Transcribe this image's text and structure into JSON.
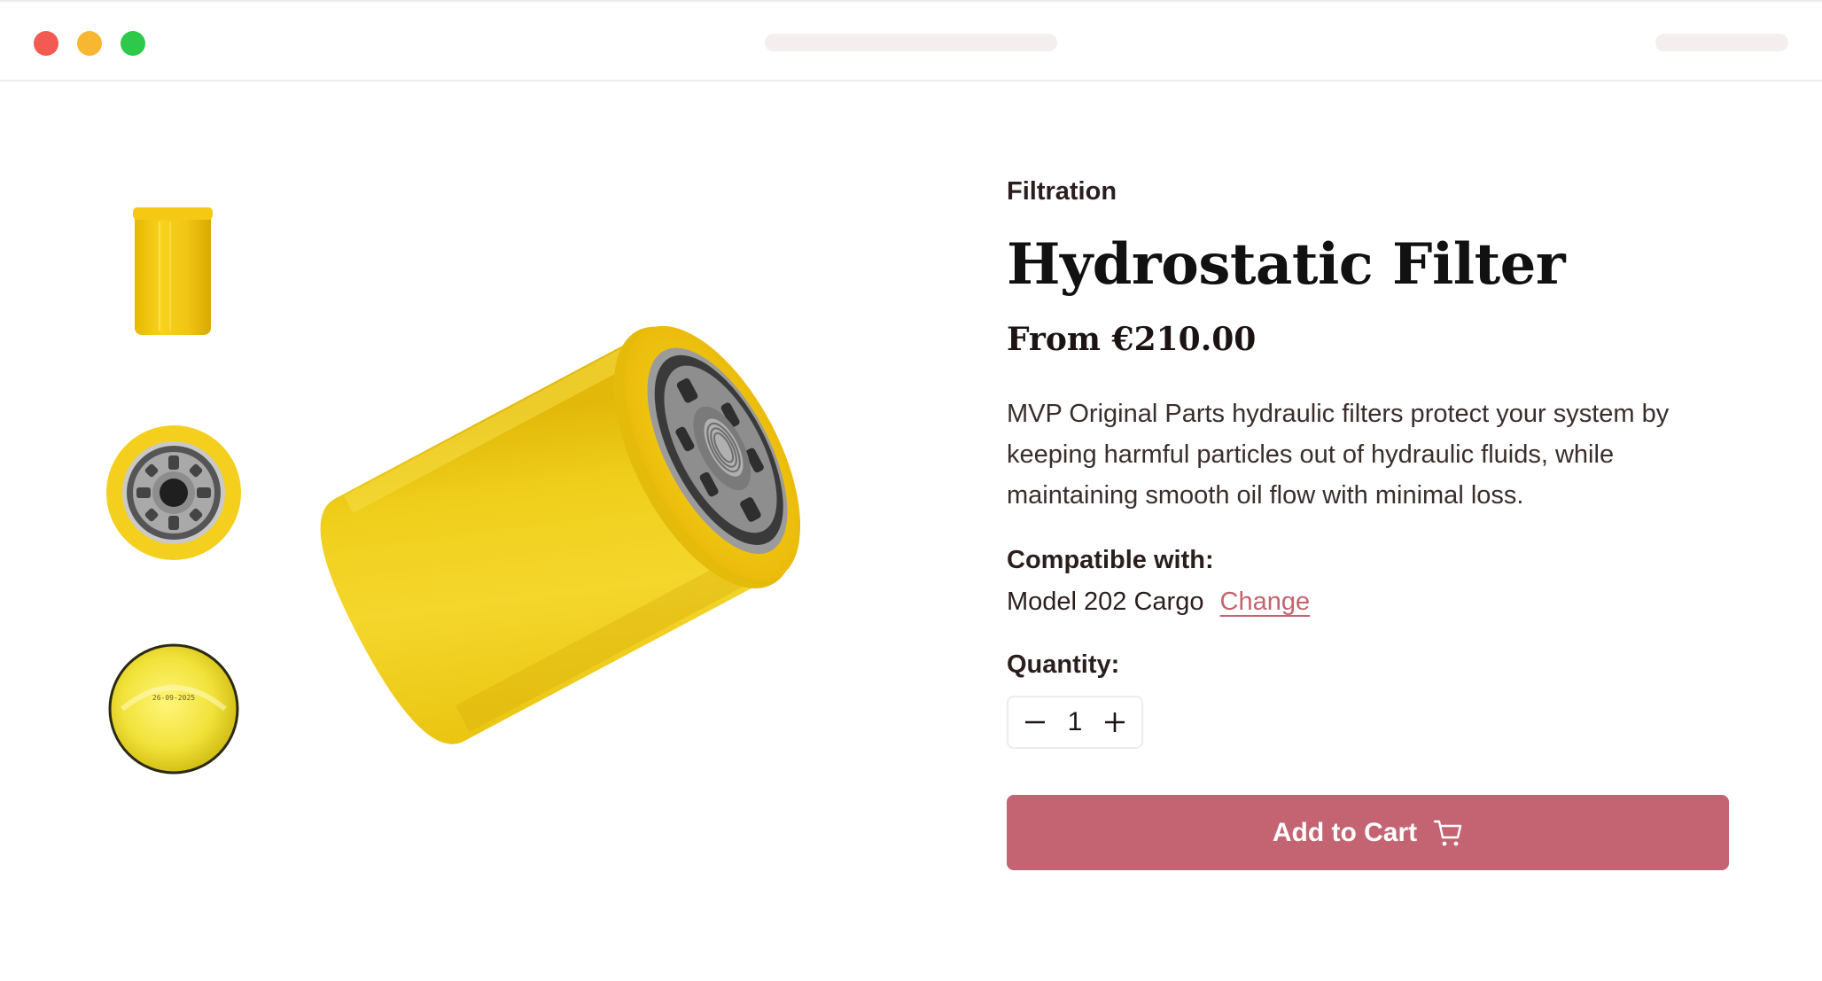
{
  "product": {
    "category": "Filtration",
    "title": "Hydrostatic Filter",
    "price": "From €210.00",
    "description": "MVP Original Parts hydraulic filters protect your system by keeping harmful particles out of hydraulic fluids, while maintaining smooth oil flow with minimal loss.",
    "compatible_label": "Compatible with:",
    "compatible_model": "Model 202 Cargo",
    "change_label": "Change",
    "quantity_label": "Quantity:",
    "quantity_value": "1",
    "add_to_cart_label": "Add to Cart"
  },
  "gallery": {
    "thumbnails": [
      "side-view",
      "top-view",
      "bottom-view"
    ],
    "bottom_stamp": "26-09-2025"
  },
  "colors": {
    "accent": "#c46472",
    "filter_yellow": "#f2cc1f"
  },
  "icons": [
    "minus-icon",
    "plus-icon",
    "cart-icon"
  ]
}
